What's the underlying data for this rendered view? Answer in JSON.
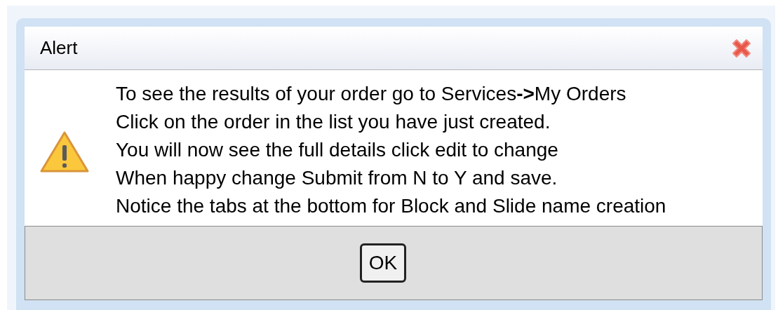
{
  "dialog": {
    "title": "Alert",
    "message_lines": [
      "To see the results of your order go to Services**->**My Orders",
      "Click on the order in the list you have just created.",
      "You will now see the full details click edit to change",
      "When happy change Submit from N to Y and save.",
      "Notice the tabs at the bottom for Block and Slide name creation"
    ],
    "buttons": [
      "OK"
    ]
  }
}
